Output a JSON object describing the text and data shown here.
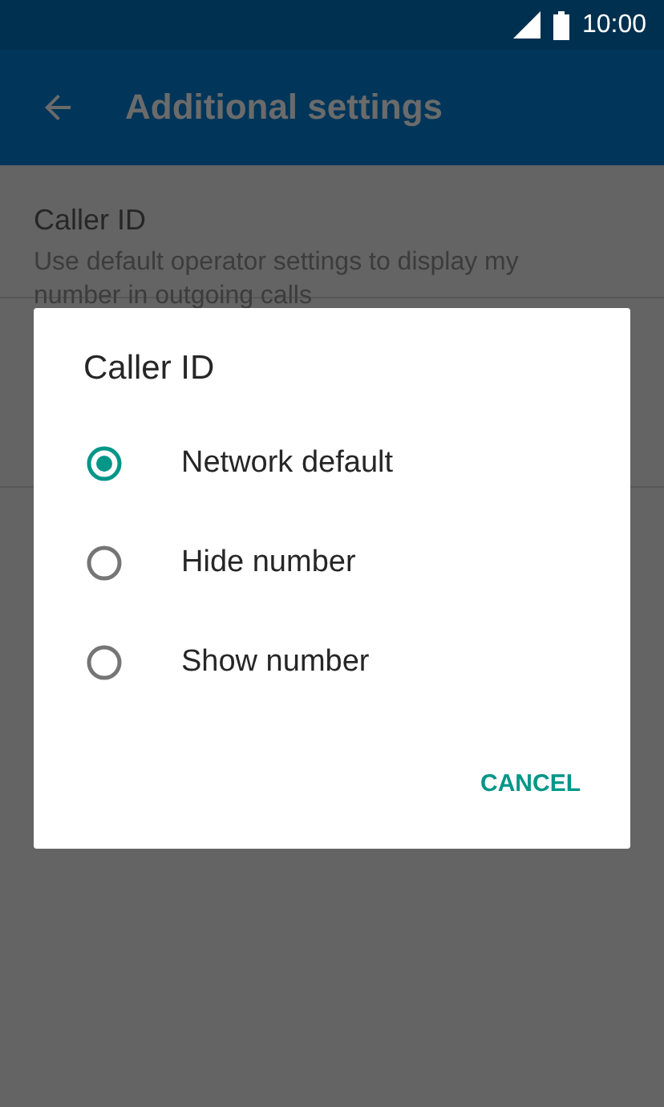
{
  "status_bar": {
    "time": "10:00"
  },
  "app_bar": {
    "title": "Additional settings"
  },
  "settings": [
    {
      "title": "Caller ID",
      "summary": "Use default operator settings to display my number in outgoing calls"
    }
  ],
  "dialog": {
    "title": "Caller ID",
    "options": [
      {
        "label": "Network default",
        "selected": true
      },
      {
        "label": "Hide number",
        "selected": false
      },
      {
        "label": "Show number",
        "selected": false
      }
    ],
    "buttons": [
      "CANCEL"
    ]
  }
}
